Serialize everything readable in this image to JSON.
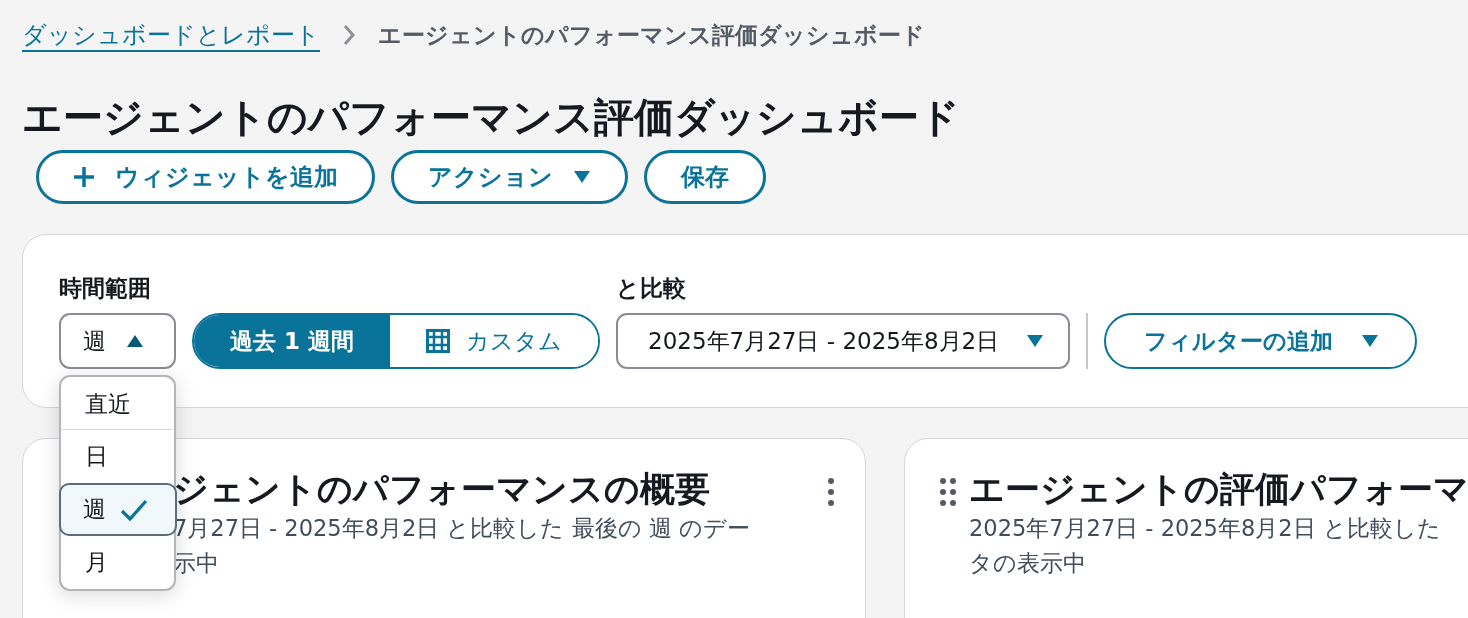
{
  "breadcrumb": [
    {
      "label": "ダッシュボードとレポート",
      "kind": "link"
    },
    {
      "label": "エージェントのパフォーマンス評価ダッシュボード",
      "kind": "current"
    }
  ],
  "page_title": "エージェントのパフォーマンス評価ダッシュボード",
  "actions": [
    {
      "label": "ウィジェットを追加",
      "kind": "add"
    },
    {
      "label": "アクション",
      "kind": "menu"
    },
    {
      "label": "保存",
      "kind": "plain"
    }
  ],
  "filters": {
    "time_range": {
      "label": "時間範囲",
      "value": "週",
      "expanded": true,
      "options": [
        {
          "label": "直近",
          "selected": false
        },
        {
          "label": "日",
          "selected": false
        },
        {
          "label": "週",
          "selected": true
        },
        {
          "label": "月",
          "selected": false
        }
      ]
    },
    "period": [
      {
        "label": "過去 1 週間",
        "kind": "text",
        "selected": true
      },
      {
        "label": "カスタム",
        "kind": "calendar",
        "selected": false
      }
    ],
    "compare": {
      "label": "と比較",
      "value": "2025年7月27日 - 2025年8月2日"
    },
    "add_filter": "フィルターの追加"
  },
  "widgets": [
    {
      "kind": "menu",
      "title": "ジェントのパフォーマンスの概要",
      "description_lines": [
        "7月27日 - 2025年8月2日 と比較した 最後の 週 のデー",
        "示中"
      ]
    },
    {
      "kind": "drag",
      "title": "エージェントの評価パフォーマ",
      "description_lines": [
        "2025年7月27日 - 2025年8月2日 と比較した",
        "タの表示中"
      ]
    }
  ]
}
